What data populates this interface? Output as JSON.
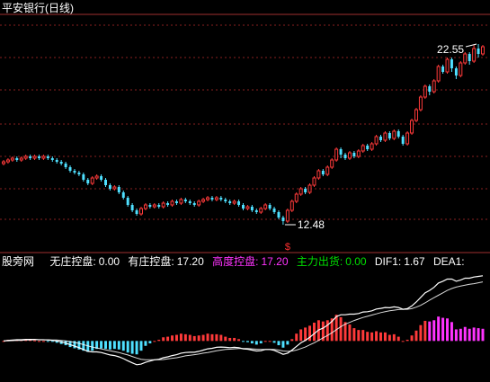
{
  "chart_data": {
    "type": "candlestick",
    "title": "平安银行(日线)",
    "upper_panel": {
      "ylim": [
        11.5,
        24.0
      ],
      "high_label": "22.55",
      "low_label": "12.48",
      "gridlines": [
        23.6,
        21.8,
        20.0,
        18.1,
        16.3,
        14.5,
        12.8
      ],
      "candles": [
        [
          15.9,
          16.0,
          16.1,
          15.8
        ],
        [
          16.0,
          16.1,
          16.2,
          15.9
        ],
        [
          16.1,
          16.2,
          16.3,
          16.0
        ],
        [
          16.2,
          16.1,
          16.3,
          16.0
        ],
        [
          16.1,
          16.2,
          16.3,
          16.0
        ],
        [
          16.2,
          16.3,
          16.4,
          16.1
        ],
        [
          16.3,
          16.2,
          16.4,
          16.1
        ],
        [
          16.2,
          16.3,
          16.4,
          16.1
        ],
        [
          16.3,
          16.2,
          16.4,
          16.1
        ],
        [
          16.2,
          16.3,
          16.4,
          16.1
        ],
        [
          16.3,
          16.2,
          16.4,
          16.1
        ],
        [
          16.2,
          16.1,
          16.3,
          16.0
        ],
        [
          16.1,
          16.0,
          16.2,
          15.9
        ],
        [
          16.0,
          15.9,
          16.1,
          15.8
        ],
        [
          15.9,
          15.7,
          16.0,
          15.6
        ],
        [
          15.7,
          15.5,
          15.8,
          15.4
        ],
        [
          15.5,
          15.4,
          15.6,
          15.3
        ],
        [
          15.4,
          15.3,
          15.5,
          15.2
        ],
        [
          15.3,
          15.0,
          15.4,
          14.9
        ],
        [
          15.0,
          14.8,
          15.1,
          14.7
        ],
        [
          14.8,
          15.1,
          15.2,
          14.7
        ],
        [
          15.1,
          15.2,
          15.3,
          15.0
        ],
        [
          15.2,
          15.0,
          15.3,
          14.9
        ],
        [
          15.0,
          14.7,
          15.1,
          14.6
        ],
        [
          14.7,
          14.5,
          14.8,
          14.4
        ],
        [
          14.5,
          14.6,
          14.7,
          14.4
        ],
        [
          14.6,
          14.3,
          14.7,
          14.2
        ],
        [
          14.3,
          14.0,
          14.4,
          13.9
        ],
        [
          14.0,
          13.6,
          14.1,
          13.5
        ],
        [
          13.6,
          13.3,
          13.7,
          13.2
        ],
        [
          13.3,
          13.1,
          13.4,
          13.0
        ],
        [
          13.1,
          13.4,
          13.5,
          13.0
        ],
        [
          13.4,
          13.6,
          13.7,
          13.3
        ],
        [
          13.6,
          13.5,
          13.7,
          13.4
        ],
        [
          13.5,
          13.6,
          13.7,
          13.4
        ],
        [
          13.6,
          13.5,
          13.7,
          13.4
        ],
        [
          13.5,
          13.7,
          13.8,
          13.4
        ],
        [
          13.7,
          13.6,
          13.8,
          13.5
        ],
        [
          13.6,
          13.8,
          13.9,
          13.5
        ],
        [
          13.8,
          13.7,
          13.9,
          13.6
        ],
        [
          13.7,
          13.9,
          14.0,
          13.6
        ],
        [
          13.9,
          13.8,
          14.0,
          13.7
        ],
        [
          13.8,
          13.7,
          13.9,
          13.6
        ],
        [
          13.7,
          13.6,
          13.8,
          13.5
        ],
        [
          13.6,
          13.8,
          13.9,
          13.5
        ],
        [
          13.8,
          13.9,
          14.0,
          13.7
        ],
        [
          13.9,
          14.0,
          14.1,
          13.8
        ],
        [
          14.0,
          13.9,
          14.1,
          13.8
        ],
        [
          13.9,
          14.0,
          14.1,
          13.8
        ],
        [
          14.0,
          13.9,
          14.1,
          13.8
        ],
        [
          13.9,
          13.8,
          14.0,
          13.7
        ],
        [
          13.8,
          13.7,
          13.9,
          13.6
        ],
        [
          13.7,
          13.8,
          13.9,
          13.6
        ],
        [
          13.8,
          13.6,
          13.9,
          13.5
        ],
        [
          13.6,
          13.4,
          13.7,
          13.3
        ],
        [
          13.4,
          13.5,
          13.6,
          13.3
        ],
        [
          13.5,
          13.3,
          13.6,
          13.2
        ],
        [
          13.3,
          13.2,
          13.4,
          13.1
        ],
        [
          13.2,
          13.4,
          13.5,
          13.1
        ],
        [
          13.4,
          13.6,
          13.7,
          13.3
        ],
        [
          13.6,
          13.4,
          13.7,
          13.3
        ],
        [
          13.4,
          13.2,
          13.5,
          13.1
        ],
        [
          13.2,
          12.9,
          13.3,
          12.8
        ],
        [
          12.9,
          12.7,
          13.0,
          12.5
        ],
        [
          12.7,
          13.3,
          13.4,
          12.6
        ],
        [
          13.3,
          13.8,
          13.9,
          13.2
        ],
        [
          13.8,
          14.2,
          14.3,
          13.7
        ],
        [
          14.2,
          14.5,
          14.6,
          14.1
        ],
        [
          14.5,
          14.3,
          14.6,
          14.2
        ],
        [
          14.3,
          14.7,
          14.8,
          14.2
        ],
        [
          14.7,
          15.1,
          15.2,
          14.6
        ],
        [
          15.1,
          15.5,
          15.6,
          15.0
        ],
        [
          15.5,
          15.3,
          15.6,
          15.2
        ],
        [
          15.3,
          15.7,
          15.8,
          15.2
        ],
        [
          15.7,
          16.1,
          16.2,
          15.6
        ],
        [
          16.1,
          16.7,
          16.8,
          16.0
        ],
        [
          16.7,
          16.4,
          16.8,
          16.2
        ],
        [
          16.4,
          16.2,
          16.5,
          16.1
        ],
        [
          16.2,
          16.5,
          16.6,
          16.1
        ],
        [
          16.5,
          16.3,
          16.6,
          16.2
        ],
        [
          16.3,
          16.6,
          16.7,
          16.2
        ],
        [
          16.6,
          16.9,
          17.0,
          16.5
        ],
        [
          16.9,
          16.7,
          17.0,
          16.6
        ],
        [
          16.7,
          17.0,
          17.1,
          16.6
        ],
        [
          17.0,
          17.4,
          17.5,
          16.9
        ],
        [
          17.4,
          17.2,
          17.5,
          17.1
        ],
        [
          17.2,
          17.6,
          17.7,
          17.1
        ],
        [
          17.6,
          17.3,
          17.7,
          17.2
        ],
        [
          17.3,
          17.7,
          17.8,
          17.2
        ],
        [
          17.7,
          17.4,
          17.8,
          17.3
        ],
        [
          17.4,
          17.0,
          17.5,
          16.9
        ],
        [
          17.0,
          17.6,
          17.7,
          16.9
        ],
        [
          17.6,
          18.3,
          18.4,
          17.5
        ],
        [
          18.3,
          18.9,
          19.0,
          18.2
        ],
        [
          18.9,
          19.6,
          19.7,
          18.8
        ],
        [
          19.6,
          20.2,
          20.3,
          19.5
        ],
        [
          20.2,
          19.9,
          20.3,
          19.7
        ],
        [
          19.9,
          20.5,
          20.6,
          19.8
        ],
        [
          20.5,
          21.3,
          21.4,
          20.4
        ],
        [
          21.3,
          21.0,
          21.4,
          20.9
        ],
        [
          21.0,
          21.7,
          21.8,
          20.9
        ],
        [
          21.7,
          21.2,
          21.8,
          21.0
        ],
        [
          21.2,
          20.8,
          21.3,
          20.6
        ],
        [
          20.8,
          21.5,
          21.6,
          20.7
        ],
        [
          21.5,
          22.0,
          22.1,
          21.4
        ],
        [
          22.0,
          21.6,
          22.1,
          21.4
        ],
        [
          21.6,
          22.3,
          22.5,
          21.5
        ],
        [
          22.3,
          22.0,
          22.55,
          21.8
        ],
        [
          22.0,
          22.4,
          22.5,
          21.9
        ]
      ]
    },
    "legend": {
      "site": "股旁网",
      "items": [
        {
          "label": "无庄控盘:",
          "value": "0.00",
          "color": "#ffffff"
        },
        {
          "label": "有庄控盘:",
          "value": "17.20",
          "color": "#ffffff"
        },
        {
          "label": "高度控盘:",
          "value": "17.20",
          "color": "#ff33ff"
        },
        {
          "label": "主力出货:",
          "value": "0.00",
          "color": "#00e000"
        },
        {
          "label": "DIF1:",
          "value": "1.67",
          "color": "#ffffff"
        },
        {
          "label": "DEA1:",
          "value": "",
          "color": "#ffffff"
        }
      ]
    },
    "signal_marker": "$",
    "lower_panel": {
      "ylim": [
        -1.2,
        2.4
      ],
      "dif": [
        0.0,
        0.02,
        0.03,
        0.04,
        0.04,
        0.05,
        0.05,
        0.05,
        0.04,
        0.04,
        0.03,
        0.02,
        0.0,
        -0.03,
        -0.07,
        -0.12,
        -0.17,
        -0.22,
        -0.28,
        -0.34,
        -0.36,
        -0.36,
        -0.38,
        -0.42,
        -0.46,
        -0.48,
        -0.52,
        -0.58,
        -0.65,
        -0.72,
        -0.78,
        -0.76,
        -0.7,
        -0.66,
        -0.62,
        -0.6,
        -0.55,
        -0.52,
        -0.48,
        -0.45,
        -0.4,
        -0.38,
        -0.37,
        -0.37,
        -0.34,
        -0.3,
        -0.26,
        -0.24,
        -0.21,
        -0.2,
        -0.21,
        -0.22,
        -0.21,
        -0.22,
        -0.26,
        -0.27,
        -0.3,
        -0.33,
        -0.32,
        -0.28,
        -0.28,
        -0.31,
        -0.37,
        -0.44,
        -0.4,
        -0.3,
        -0.18,
        -0.06,
        0.02,
        0.12,
        0.24,
        0.36,
        0.42,
        0.52,
        0.64,
        0.8,
        0.86,
        0.86,
        0.88,
        0.88,
        0.9,
        0.95,
        0.96,
        0.99,
        1.05,
        1.07,
        1.1,
        1.09,
        1.12,
        1.1,
        1.04,
        1.06,
        1.15,
        1.28,
        1.43,
        1.58,
        1.66,
        1.76,
        1.9,
        1.96,
        2.03,
        2.03,
        1.96,
        2.0,
        2.06,
        2.06,
        2.1,
        2.12,
        2.14
      ],
      "dea": [
        0.0,
        0.0,
        0.01,
        0.02,
        0.02,
        0.03,
        0.03,
        0.04,
        0.04,
        0.04,
        0.04,
        0.03,
        0.03,
        0.02,
        0.0,
        -0.02,
        -0.05,
        -0.08,
        -0.12,
        -0.16,
        -0.2,
        -0.23,
        -0.26,
        -0.29,
        -0.32,
        -0.35,
        -0.38,
        -0.42,
        -0.46,
        -0.51,
        -0.56,
        -0.6,
        -0.62,
        -0.62,
        -0.62,
        -0.62,
        -0.61,
        -0.59,
        -0.57,
        -0.55,
        -0.52,
        -0.49,
        -0.47,
        -0.45,
        -0.43,
        -0.4,
        -0.38,
        -0.35,
        -0.32,
        -0.3,
        -0.28,
        -0.27,
        -0.26,
        -0.25,
        -0.25,
        -0.25,
        -0.26,
        -0.27,
        -0.28,
        -0.28,
        -0.28,
        -0.28,
        -0.3,
        -0.33,
        -0.34,
        -0.33,
        -0.3,
        -0.25,
        -0.2,
        -0.13,
        -0.06,
        0.02,
        0.1,
        0.18,
        0.27,
        0.37,
        0.47,
        0.55,
        0.61,
        0.67,
        0.72,
        0.77,
        0.81,
        0.85,
        0.89,
        0.93,
        0.96,
        0.99,
        1.01,
        1.03,
        1.04,
        1.04,
        1.06,
        1.11,
        1.17,
        1.25,
        1.34,
        1.42,
        1.5,
        1.58,
        1.66,
        1.72,
        1.77,
        1.8,
        1.83,
        1.86,
        1.88,
        1.91,
        1.94
      ]
    }
  }
}
